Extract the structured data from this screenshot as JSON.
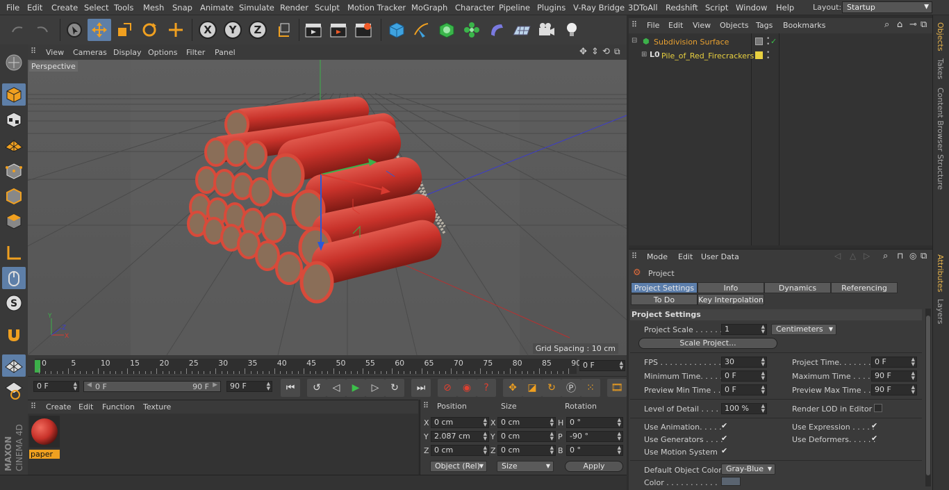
{
  "menubar": {
    "items": [
      "File",
      "Edit",
      "Create",
      "Select",
      "Tools",
      "Mesh",
      "Snap",
      "Animate",
      "Simulate",
      "Render",
      "Sculpt",
      "Motion Tracker",
      "MoGraph",
      "Character",
      "Pipeline",
      "Plugins",
      "V-Ray Bridge",
      "3DToAll",
      "Redshift",
      "Script",
      "Window",
      "Help"
    ],
    "layout_label": "Layout:",
    "layout_value": "Startup"
  },
  "viewport": {
    "menu": [
      "View",
      "Cameras",
      "Display",
      "Options",
      "Filter",
      "Panel"
    ],
    "camera_label": "Perspective",
    "grid_spacing": "Grid Spacing : 10 cm"
  },
  "timeline": {
    "ticks": [
      "0",
      "5",
      "10",
      "15",
      "20",
      "25",
      "30",
      "35",
      "40",
      "45",
      "50",
      "55",
      "60",
      "65",
      "70",
      "75",
      "80",
      "85",
      "90"
    ],
    "current_frame": "0 F",
    "start_field": "0 F",
    "range_start": "0 F",
    "range_end": "90 F",
    "end_field": "90 F"
  },
  "material_manager": {
    "menu": [
      "Create",
      "Edit",
      "Function",
      "Texture"
    ],
    "material_name": "paper"
  },
  "coordinates": {
    "headers": [
      "Position",
      "Size",
      "Rotation"
    ],
    "rows": [
      {
        "axis": "X",
        "pos": "0 cm",
        "size_axis": "X",
        "size": "0 cm",
        "rot_axis": "H",
        "rot": "0 °"
      },
      {
        "axis": "Y",
        "pos": "2.087 cm",
        "size_axis": "Y",
        "size": "0 cm",
        "rot_axis": "P",
        "rot": "-90 °"
      },
      {
        "axis": "Z",
        "pos": "0 cm",
        "size_axis": "Z",
        "size": "0 cm",
        "rot_axis": "B",
        "rot": "0 °"
      }
    ],
    "mode": "Object (Rel)",
    "size_mode": "Size",
    "apply": "Apply"
  },
  "object_manager": {
    "menu": [
      "File",
      "Edit",
      "View",
      "Objects",
      "Tags",
      "Bookmarks"
    ],
    "objects": [
      {
        "name": "Subdivision Surface",
        "color": "#e8a030"
      },
      {
        "name": "Pile_of_Red_Firecrackers",
        "color": "#e8d040"
      }
    ]
  },
  "side_tabs": {
    "top": [
      "Objects",
      "Takes",
      "Content Browser",
      "Structure"
    ],
    "bottom": [
      "Attributes",
      "Layers"
    ]
  },
  "attributes": {
    "menu": [
      "Mode",
      "Edit",
      "User Data"
    ],
    "object": "Project",
    "tabs_row1": [
      "Project Settings",
      "Info",
      "Dynamics",
      "Referencing"
    ],
    "tabs_row2": [
      "To Do",
      "Key Interpolation"
    ],
    "section": "Project Settings",
    "project_scale_label": "Project Scale . . . . . .",
    "project_scale_value": "1",
    "project_scale_unit": "Centimeters",
    "scale_project_button": "Scale Project...",
    "fps_label": "FPS . . . . . . . . . . . . . .",
    "fps_value": "30",
    "project_time_label": "Project Time. . . . . . . .",
    "project_time_value": "0 F",
    "min_time_label": "Minimum Time. . . . . . .",
    "min_time_value": "0 F",
    "max_time_label": "Maximum Time . . . . . .",
    "max_time_value": "90 F",
    "prev_min_label": "Preview Min Time . . .",
    "prev_min_value": "0 F",
    "prev_max_label": "Preview Max Time . . .",
    "prev_max_value": "90 F",
    "lod_label": "Level of Detail . . . . . .",
    "lod_value": "100 %",
    "render_lod_label": "Render LOD in Editor",
    "use_animation": "Use Animation. . . . .",
    "use_expression": "Use Expression . . . . .",
    "use_generators": "Use Generators . . . .",
    "use_deformers": "Use Deformers. . . . . .",
    "use_motion": "Use Motion System",
    "default_color_label": "Default Object Color",
    "default_color_value": "Gray-Blue",
    "color_label": "Color . . . . . . . . . . ."
  },
  "colors": {
    "accent": "#5e7fa8",
    "firecracker_red": "#c8322a",
    "object_orange": "#e8a030"
  }
}
